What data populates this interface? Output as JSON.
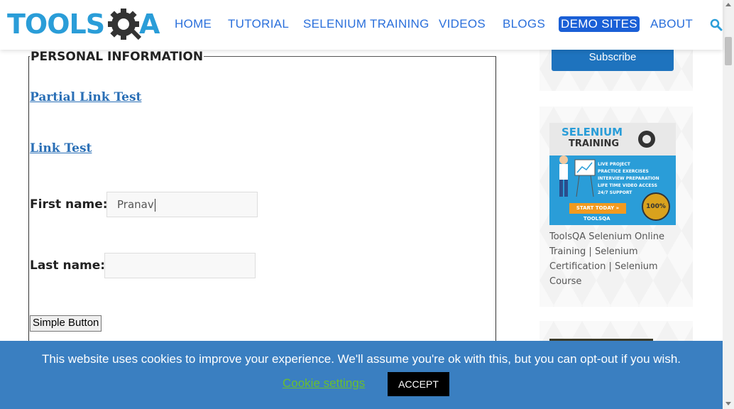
{
  "brand": {
    "logo_text": "TOOLS",
    "logo_suffix": "A"
  },
  "nav": {
    "items": [
      {
        "label": "HOME"
      },
      {
        "label": "TUTORIAL"
      },
      {
        "label": "SELENIUM TRAINING"
      },
      {
        "label": "VIDEOS"
      },
      {
        "label": "BLOGS"
      },
      {
        "label": "DEMO SITES",
        "active": true
      },
      {
        "label": "ABOUT"
      }
    ],
    "search_icon": "search-icon"
  },
  "form": {
    "legend": "PERSONAL INFORMATION",
    "partial_link": "Partial Link Test",
    "link": "Link Test",
    "first_name_label": "First name:",
    "first_name_value": "Pranav",
    "last_name_label": "Last name:",
    "last_name_value": "",
    "simple_button": "Simple Button"
  },
  "sidebar": {
    "subscribe_label": "Subscribe",
    "ad": {
      "title_line1": "SELENIUM",
      "title_line2": "TRAINING",
      "bullets": [
        "LIVE PROJECT",
        "PRACTICE EXERCISES",
        "INTERVIEW PREPARATION",
        "LIFE TIME VIDEO ACCESS",
        "24/7 SUPPORT"
      ],
      "cta": "START TODAY »",
      "badge": "100%",
      "brand": "TOOLSQA"
    },
    "ad_caption": "ToolsQA Selenium Online Training | Selenium Certification | Selenium Course"
  },
  "cookie": {
    "message": "This website uses cookies to improve your experience. We'll assume you're ok with this, but you can opt-out if you wish.",
    "settings_label": "Cookie settings",
    "accept_label": "ACCEPT"
  },
  "colors": {
    "brand_blue": "#2a9dd8",
    "nav_blue": "#2a6fdb",
    "active_nav_bg": "#1a5fd6",
    "cookie_bar": "#3a7fc1",
    "subscribe_bg": "#1e73be",
    "cookie_settings": "#6bbf2e"
  }
}
